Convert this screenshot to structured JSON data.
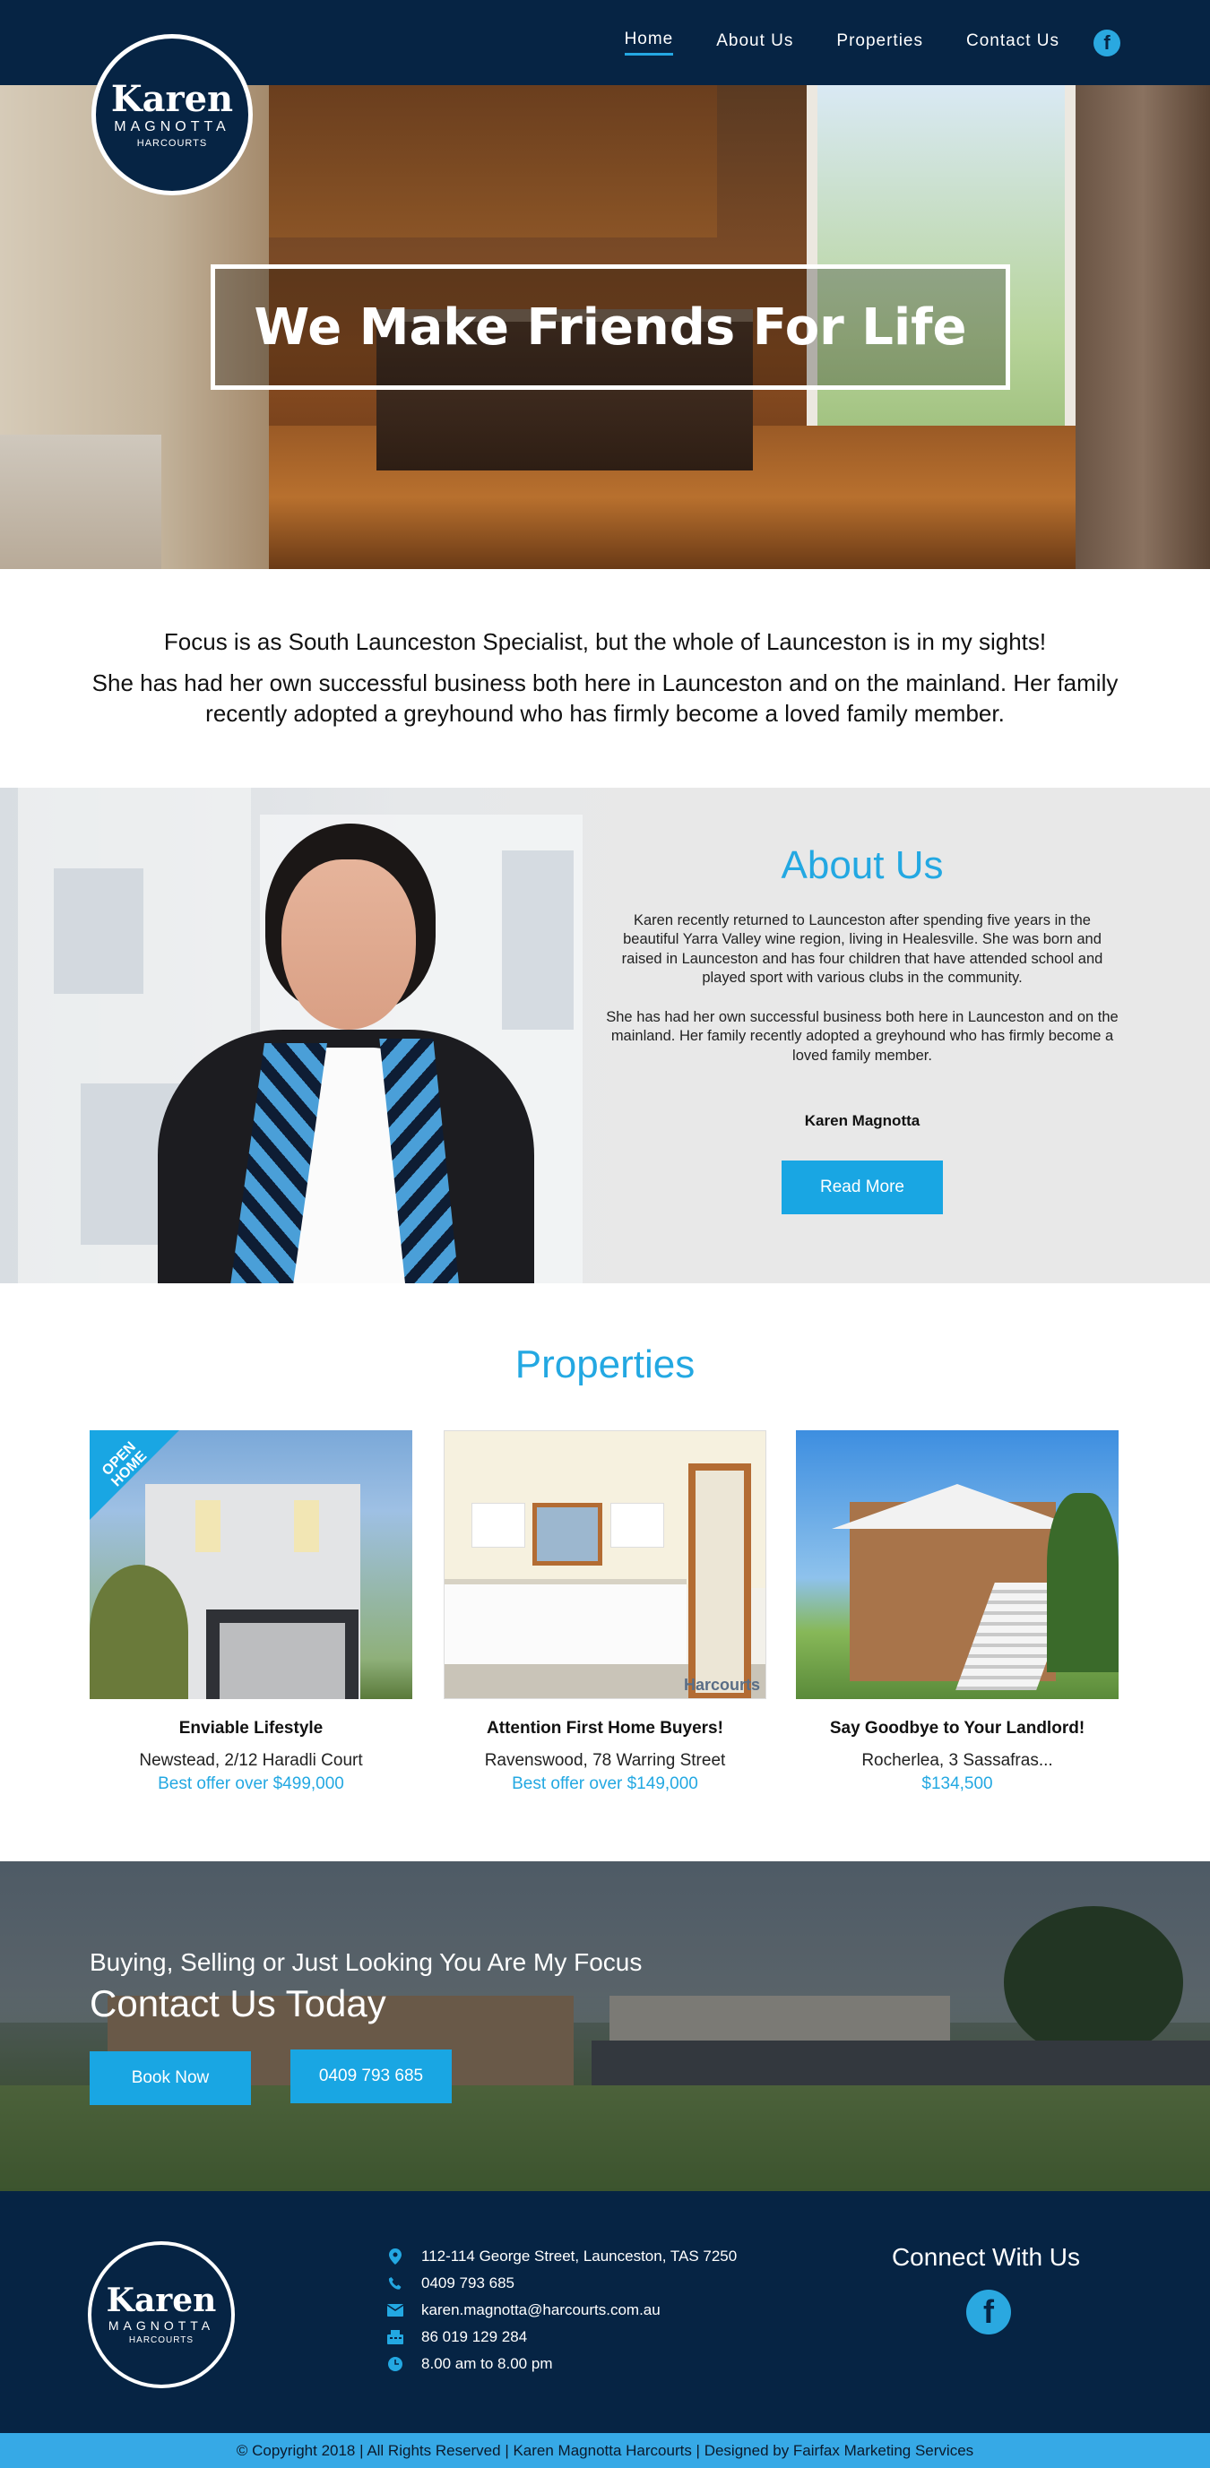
{
  "nav": {
    "items": [
      {
        "label": "Home",
        "active": true
      },
      {
        "label": "About Us"
      },
      {
        "label": "Properties"
      },
      {
        "label": "Contact Us"
      }
    ],
    "facebook_icon": "facebook-icon"
  },
  "logo": {
    "name": "Karen",
    "surname": "MAGNOTTA",
    "brand": "HARCOURTS"
  },
  "hero": {
    "title": "We Make Friends For Life"
  },
  "intro": {
    "line1": "Focus is as South Launceston Specialist,  but the whole of Launceston is in my sights!",
    "line2": "She has had her own successful business both here in Launceston and on the mainland. Her family recently adopted a greyhound who has firmly become a loved family member."
  },
  "about": {
    "title": "About Us",
    "para1": "Karen recently returned to Launceston after spending five years in the beautiful Yarra Valley wine region, living in Healesville. She was born and raised in Launceston and has four children that have attended school and played sport with various clubs in the community.",
    "para2": "She has had her own successful business both here in Launceston and on the mainland. Her family recently adopted a greyhound who has firmly become a loved family member.",
    "signature": "Karen Magnotta",
    "button": "Read More"
  },
  "properties": {
    "title": "Properties",
    "ribbon": "OPEN HOME",
    "watermark": "Harcourts",
    "items": [
      {
        "title": "Enviable Lifestyle",
        "address": "Newstead, 2/12 Haradli Court",
        "price": "Best offer over $499,000"
      },
      {
        "title": "Attention First Home Buyers!",
        "address": "Ravenswood, 78 Warring Street",
        "price": "Best offer over $149,000"
      },
      {
        "title": "Say Goodbye to Your Landlord!",
        "address": "Rocherlea, 3 Sassafras...",
        "price": "$134,500"
      }
    ]
  },
  "cta": {
    "subtitle": "Buying, Selling or Just Looking You Are My Focus",
    "title": "Contact Us Today",
    "book_button": "Book Now",
    "phone_button": "0409 793 685"
  },
  "footer": {
    "address": "112-114 George Street, Launceston, TAS 7250",
    "phone": "0409 793 685",
    "email": "karen.magnotta@harcourts.com.au",
    "fax": "86 019 129 284",
    "hours": "8.00 am to 8.00 pm",
    "connect": "Connect With Us",
    "copyright": "© Copyright 2018 | All Rights Reserved | Karen Magnotta Harcourts | Designed by Fairfax Marketing Services"
  },
  "colors": {
    "navy": "#062444",
    "accent": "#23a8e2",
    "button": "#19a6e3",
    "copyright_bar": "#36a9e6"
  }
}
